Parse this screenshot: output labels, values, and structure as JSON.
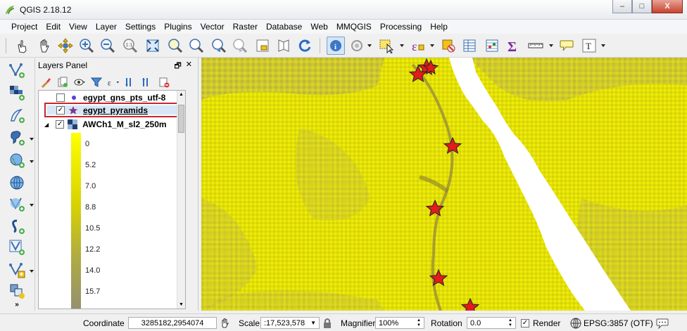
{
  "window": {
    "title": "QGIS 2.18.12",
    "buttons": [
      "–",
      "□",
      "X"
    ]
  },
  "menu": [
    "Project",
    "Edit",
    "View",
    "Layer",
    "Settings",
    "Plugins",
    "Vector",
    "Raster",
    "Database",
    "Web",
    "MMQGIS",
    "Processing",
    "Help"
  ],
  "layers_panel": {
    "title": "Layers Panel",
    "layers": [
      {
        "name": "egypt_gns_pts_utf-8",
        "checked": false
      },
      {
        "name": "egypt_pyramids",
        "checked": true,
        "selected": true
      },
      {
        "name": "AWCh1_M_sl2_250m",
        "checked": true,
        "expanded": true
      }
    ],
    "legend_values": [
      "0",
      "5.2",
      "7.0",
      "8.8",
      "10.5",
      "12.2",
      "14.0",
      "15.7"
    ]
  },
  "status": {
    "coordinate_label": "Coordinate",
    "coordinate_value": "3285182,2954074",
    "scale_label": "Scale",
    "scale_value": ":17,523,578",
    "magnifier_label": "Magnifier",
    "magnifier_value": "100%",
    "rotation_label": "Rotation",
    "rotation_value": "0.0",
    "render_label": "Render",
    "render_checked": true,
    "crs_label": "EPSG:3857 (OTF)"
  },
  "colors": {
    "raster_bright": "#e8e600",
    "raster_dark": "#a8a030",
    "marker": "#e21b1b",
    "selection_outline": "#c8262f"
  }
}
